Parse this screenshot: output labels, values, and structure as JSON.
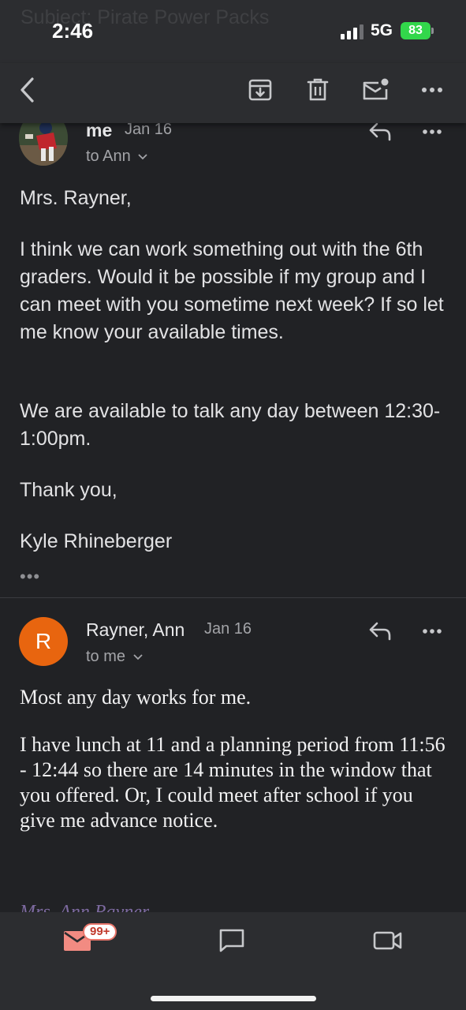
{
  "status": {
    "time": "2:46",
    "network": "5G",
    "battery": "83",
    "ghost_subject": "Subject: Pirate Power Packs"
  },
  "toolbar": {
    "back_icon": "chevron-left-icon",
    "archive_icon": "archive-icon",
    "delete_icon": "trash-icon",
    "mark_unread_icon": "mail-unread-icon",
    "more_icon": "more-horizontal-icon"
  },
  "messages": [
    {
      "sender": "me",
      "date": "Jan 16",
      "to": "to Ann",
      "body": [
        "Mrs. Rayner,",
        "I think we can work something out with the 6th graders. Would it be possible if my group and I can meet with you sometime next week? If so let me know your available times.",
        "We are available to talk any day between 12:30-1:00pm.",
        "Thank you,",
        "Kyle Rhineberger"
      ],
      "quoted": "•••"
    },
    {
      "avatar_letter": "R",
      "sender": "Rayner, Ann",
      "date": "Jan 16",
      "to": "to me",
      "body": [
        "Most any day works for me.",
        "I have lunch at 11 and a planning period from 11:56 - 12:44 so there are 14 minutes in the window that you offered. Or, I could meet after school if you give me advance notice."
      ],
      "signature": "Mrs. Ann Rayner"
    }
  ],
  "bottom_nav": {
    "mail_badge": "99+",
    "mail_icon": "mail-icon",
    "chat_icon": "chat-icon",
    "meet_icon": "video-icon"
  },
  "colors": {
    "background": "#212225",
    "bar": "#2c2d30",
    "avatar_r": "#e8650f",
    "battery": "#32d74b",
    "mail_accent": "#f28b82"
  }
}
